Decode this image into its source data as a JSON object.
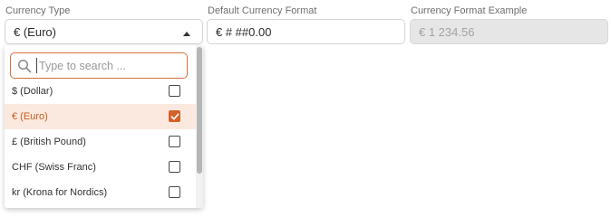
{
  "currency_type": {
    "label": "Currency Type",
    "value": "€ (Euro)",
    "dropdown": {
      "search_placeholder": "Type to search ...",
      "options": [
        {
          "label": "$ (Dollar)",
          "checked": false
        },
        {
          "label": "€ (Euro)",
          "checked": true
        },
        {
          "label": "£ (British Pound)",
          "checked": false
        },
        {
          "label": "CHF (Swiss Franc)",
          "checked": false
        },
        {
          "label": "kr (Krona for Nordics)",
          "checked": false
        }
      ]
    }
  },
  "default_currency_format": {
    "label": "Default Currency Format",
    "value": "€ # ##0.00"
  },
  "currency_format_example": {
    "label": "Currency Format Example",
    "value": "€ 1 234.56"
  },
  "colors": {
    "accent": "#d4612a",
    "selected_bg": "#fbe9df",
    "disabled_bg": "#e6e6e6"
  },
  "icons": {
    "search": "search-icon",
    "caret": "caret-up-icon",
    "check": "checkmark-icon"
  }
}
